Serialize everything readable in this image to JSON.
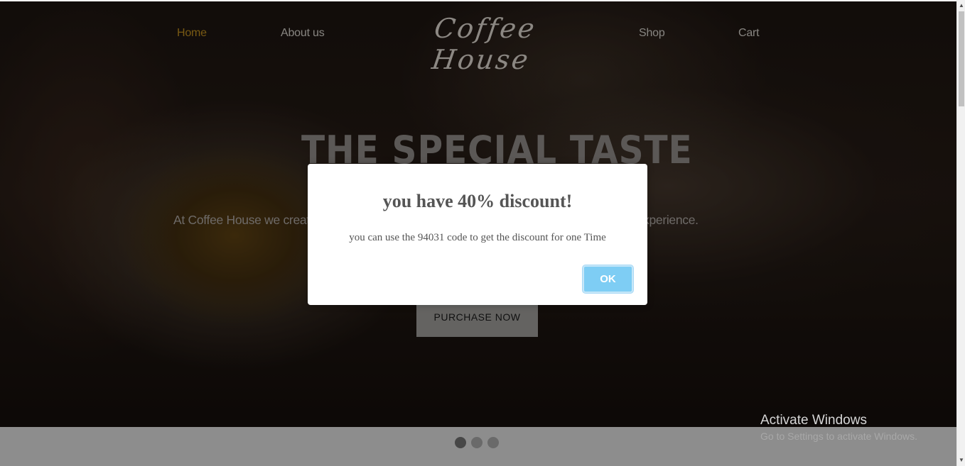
{
  "nav": {
    "home": "Home",
    "about": "About us",
    "brand": "Coffee House",
    "shop": "Shop",
    "cart": "Cart"
  },
  "hero": {
    "heading": "THE SPECIAL TASTE",
    "text": "At Coffee House we create a delicious arrays of coffee to give you an amazing sensory experience.",
    "purchase_label": "PURCHASE NOW"
  },
  "modal": {
    "title": "you have 40% discount!",
    "text": "you can use the 94031 code to get the discount for one Time",
    "ok_label": "OK"
  },
  "carousel": {
    "slides": 3,
    "active_index": 0
  },
  "watermark": {
    "title": "Activate Windows",
    "subtitle": "Go to Settings to activate Windows."
  },
  "colors": {
    "nav_active": "#b8891e",
    "ok_button": "#7ecdf4"
  }
}
